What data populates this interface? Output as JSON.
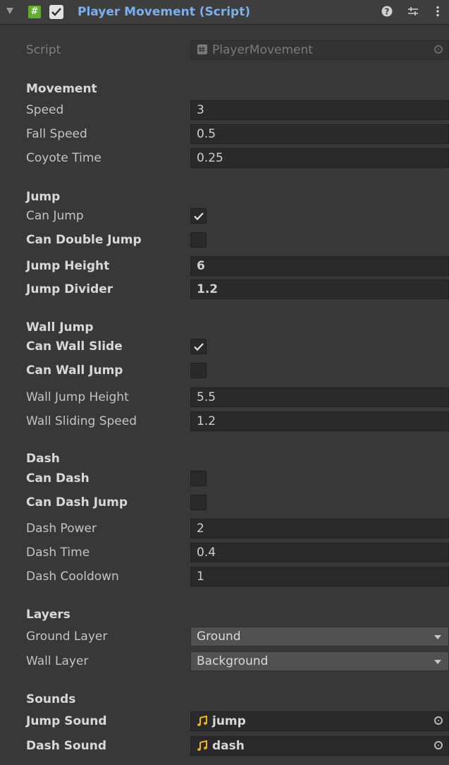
{
  "header": {
    "title": "Player Movement (Script)",
    "enabled": true,
    "script_icon": "#",
    "icons": [
      "help-icon",
      "presets-icon",
      "context-menu-icon"
    ]
  },
  "script": {
    "label": "Script",
    "value": "PlayerMovement"
  },
  "sections": {
    "movement": "Movement",
    "jump": "Jump",
    "wall_jump": "Wall Jump",
    "dash": "Dash",
    "layers": "Layers",
    "sounds": "Sounds"
  },
  "fields": {
    "speed": {
      "label": "Speed",
      "value": "3"
    },
    "fall_speed": {
      "label": "Fall Speed",
      "value": "0.5"
    },
    "coyote_time": {
      "label": "Coyote Time",
      "value": "0.25"
    },
    "can_jump": {
      "label": "Can Jump",
      "checked": true
    },
    "can_double_jump": {
      "label": "Can Double Jump",
      "checked": false
    },
    "jump_height": {
      "label": "Jump Height",
      "value": "6"
    },
    "jump_divider": {
      "label": "Jump Divider",
      "value": "1.2"
    },
    "can_wall_slide": {
      "label": "Can Wall Slide",
      "checked": true
    },
    "can_wall_jump": {
      "label": "Can Wall Jump",
      "checked": false
    },
    "wall_jump_height": {
      "label": "Wall Jump Height",
      "value": "5.5"
    },
    "wall_sliding_speed": {
      "label": "Wall Sliding Speed",
      "value": "1.2"
    },
    "can_dash": {
      "label": "Can Dash",
      "checked": false
    },
    "can_dash_jump": {
      "label": "Can Dash Jump",
      "checked": false
    },
    "dash_power": {
      "label": "Dash Power",
      "value": "2"
    },
    "dash_time": {
      "label": "Dash Time",
      "value": "0.4"
    },
    "dash_cooldown": {
      "label": "Dash Cooldown",
      "value": "1"
    },
    "ground_layer": {
      "label": "Ground Layer",
      "value": "Ground"
    },
    "wall_layer": {
      "label": "Wall Layer",
      "value": "Background"
    },
    "jump_sound": {
      "label": "Jump Sound",
      "value": "jump"
    },
    "dash_sound": {
      "label": "Dash Sound",
      "value": "dash"
    }
  },
  "colors": {
    "background": "#383838",
    "title": "#7cafed",
    "script_icon": "#5fae2f",
    "audio_icon": "#f2b61b"
  }
}
